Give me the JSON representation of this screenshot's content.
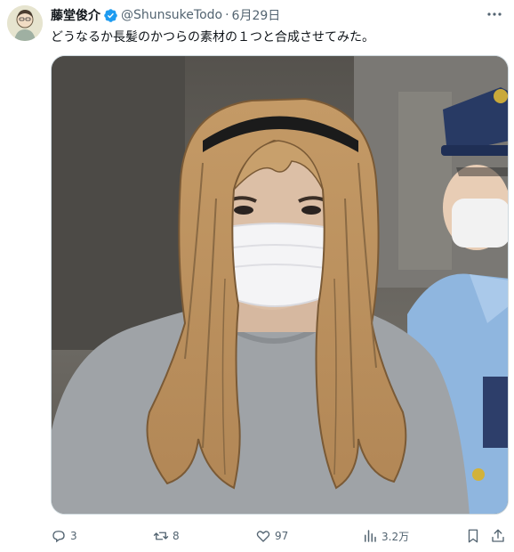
{
  "post": {
    "author": {
      "display_name": "藤堂俊介",
      "handle": "@ShunsukeTodo",
      "verified_color": "#1d9bf0"
    },
    "separator": "·",
    "date": "6月29日",
    "text": "どうなるか長髪のかつらの素材の１つと合成させてみた。",
    "actions": {
      "replies": "3",
      "reposts": "8",
      "likes": "97",
      "views": "3.2万"
    }
  },
  "icons": [
    "more-icon",
    "verified-badge-icon",
    "reply-icon",
    "repost-icon",
    "like-icon",
    "views-icon",
    "bookmark-icon",
    "share-icon"
  ]
}
